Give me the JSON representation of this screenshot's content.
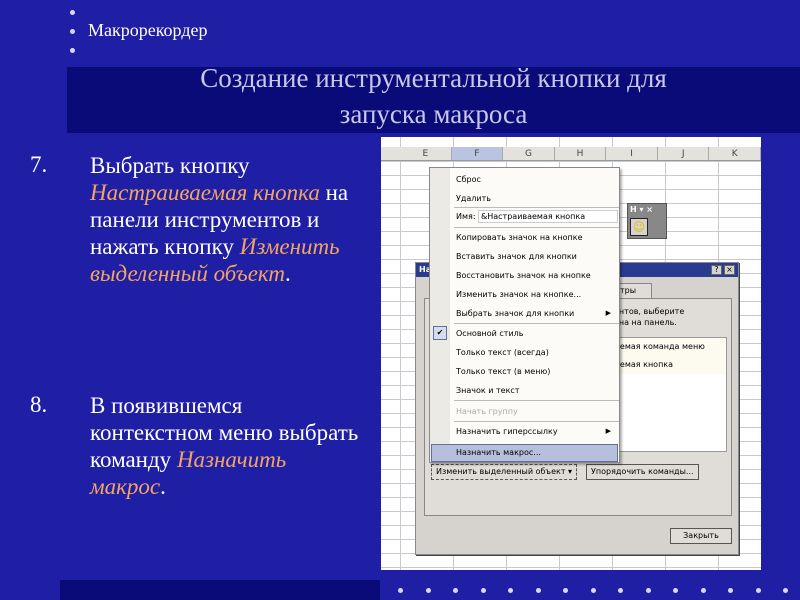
{
  "slide": {
    "topic": "Макрорекордер",
    "title_line1": "Создание инструментальной кнопки для",
    "title_line2": "запуска макроса"
  },
  "steps": [
    {
      "num": "7.",
      "t1": "Выбрать кнопку ",
      "i1": "Настраиваемая кнопка",
      "t2": " на панели инструментов и нажать кнопку ",
      "i2": "Изменить выделенный объект",
      "t3": "."
    },
    {
      "num": "8.",
      "t1": "В появившемся контекстном меню выбрать команду ",
      "i1": "Назначить макрос",
      "t2": "."
    }
  ],
  "colors": {
    "background": "#1f1fa6",
    "band": "#0a0a78",
    "accent": "#f4a460"
  },
  "screenshot": {
    "columns": [
      "E",
      "F",
      "G",
      "H",
      "I",
      "J",
      "K"
    ],
    "dialog": {
      "title": "На",
      "help": "?",
      "close": "×",
      "tab": "тры",
      "hint1": "ентов, выберите",
      "hint2": "кна на панель.",
      "list": [
        "аемая команда меню",
        "аемая кнопка"
      ],
      "modify_button": "Изменить выделенный объект ▾",
      "rearrange_button": "Упорядочить команды...",
      "close_button": "Закрыть"
    },
    "mini_toolbar": {
      "title": "Н ▾ ×",
      "icon": "smiley-icon"
    },
    "menu": {
      "items": [
        "Сброс",
        "Удалить",
        "Имя:",
        "Копировать значок на кнопке",
        "Вставить значок для кнопки",
        "Восстановить значок на кнопке",
        "Изменить значок на кнопке...",
        "Выбрать значок для кнопки",
        "Основной стиль",
        "Только текст (всегда)",
        "Только текст (в меню)",
        "Значок и текст",
        "Начать группу",
        "Назначить гиперссылку",
        "Назначить макрос..."
      ],
      "name_value": "&Настраиваемая кнопка",
      "check": "✔",
      "arrow": "▶"
    }
  }
}
